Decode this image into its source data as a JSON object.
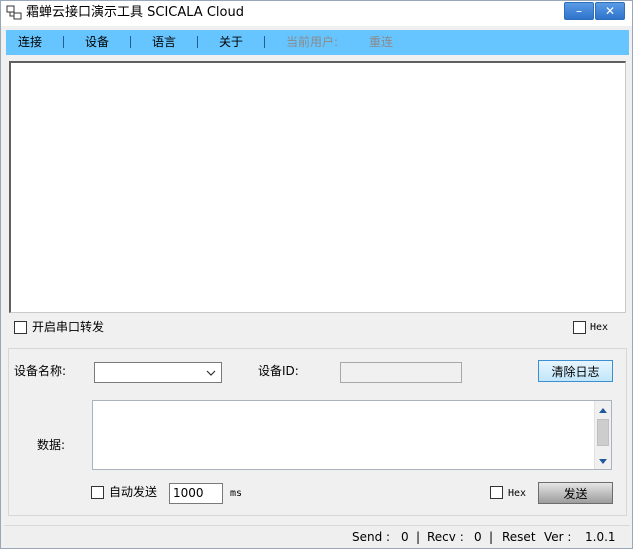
{
  "window": {
    "title": "霜蝉云接口演示工具 SCICALA Cloud",
    "minimize_glyph": "–",
    "close_glyph": "✕"
  },
  "menu": {
    "connect": "连接",
    "device": "设备",
    "language": "语言",
    "about": "关于",
    "current_user": "当前用户:",
    "reconnect": "重连"
  },
  "forward": {
    "enable_serial_forward_label": "开启串口转发",
    "hex_label": "Hex"
  },
  "send_panel": {
    "device_name_label": "设备名称:",
    "device_name_value": "",
    "device_id_label": "设备ID:",
    "device_id_value": "",
    "clear_log_button": "清除日志",
    "data_label": "数据:",
    "data_value": "",
    "auto_send_label": "自动发送",
    "interval_value": "1000",
    "interval_unit": "ms",
    "hex_label": "Hex",
    "send_button": "发送"
  },
  "status": {
    "send_label": "Send :",
    "send_count": "0",
    "recv_label": "Recv :",
    "recv_count": "0",
    "reset_label": "Reset",
    "version_label": "Ver :",
    "version_value": "1.0.1",
    "separator": "|"
  },
  "colors": {
    "menubar": "#66c5ff",
    "title_buttons": "#2f74cc",
    "clear_button": "#c1e6fb"
  }
}
